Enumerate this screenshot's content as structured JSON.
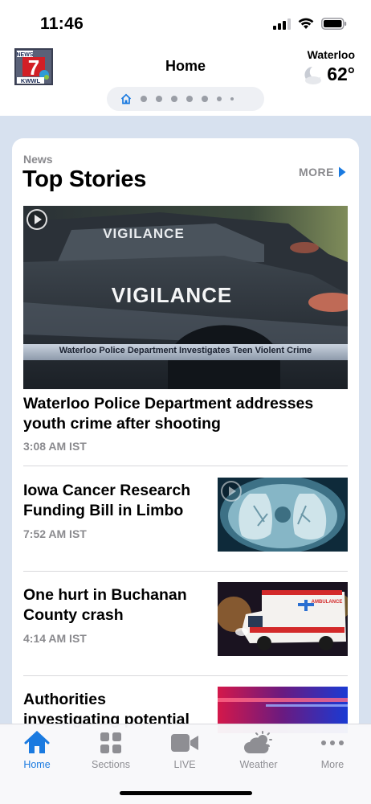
{
  "status_bar": {
    "time": "11:46"
  },
  "header": {
    "title": "Home",
    "logo_text_top": "NEWS",
    "logo_number": "7",
    "logo_text_bottom": "KWWL",
    "weather_city": "Waterloo",
    "weather_temp": "62°"
  },
  "pager": {
    "active": 0,
    "dots": 7
  },
  "section": {
    "kicker": "News",
    "heading": "Top Stories",
    "more_label": "MORE"
  },
  "lead_story": {
    "image_caption": "Waterloo Police Department Investigates Teen Violent Crime",
    "image_text_top": "VIGILANCE",
    "image_text_main": "VIGILANCE",
    "headline": "Waterloo Police Department addresses youth crime after shooting",
    "time": "3:08 AM IST",
    "has_video": true
  },
  "stories": [
    {
      "title": "Iowa Cancer Research Funding Bill in Limbo",
      "time": "7:52 AM IST",
      "thumb": "lung-scan",
      "has_video": true
    },
    {
      "title": "One hurt in Buchanan County crash",
      "time": "4:14 AM IST",
      "thumb": "ambulance",
      "has_video": false,
      "thumb_text": "AMBULANCE"
    },
    {
      "title": "Authorities investigating potential threat in Benton",
      "time": "",
      "thumb": "police-lights",
      "has_video": false
    }
  ],
  "tabbar": {
    "items": [
      {
        "label": "Home",
        "icon": "home-icon",
        "active": true
      },
      {
        "label": "Sections",
        "icon": "grid-icon",
        "active": false
      },
      {
        "label": "LIVE",
        "icon": "video-camera-icon",
        "active": false
      },
      {
        "label": "Weather",
        "icon": "weather-icon",
        "active": false
      },
      {
        "label": "More",
        "icon": "more-dots-icon",
        "active": false
      }
    ]
  },
  "colors": {
    "accent": "#1a7ae0",
    "feed_background": "#d7e1ef",
    "secondary_text": "#8a8a8e",
    "logo_red": "#d21f26"
  }
}
